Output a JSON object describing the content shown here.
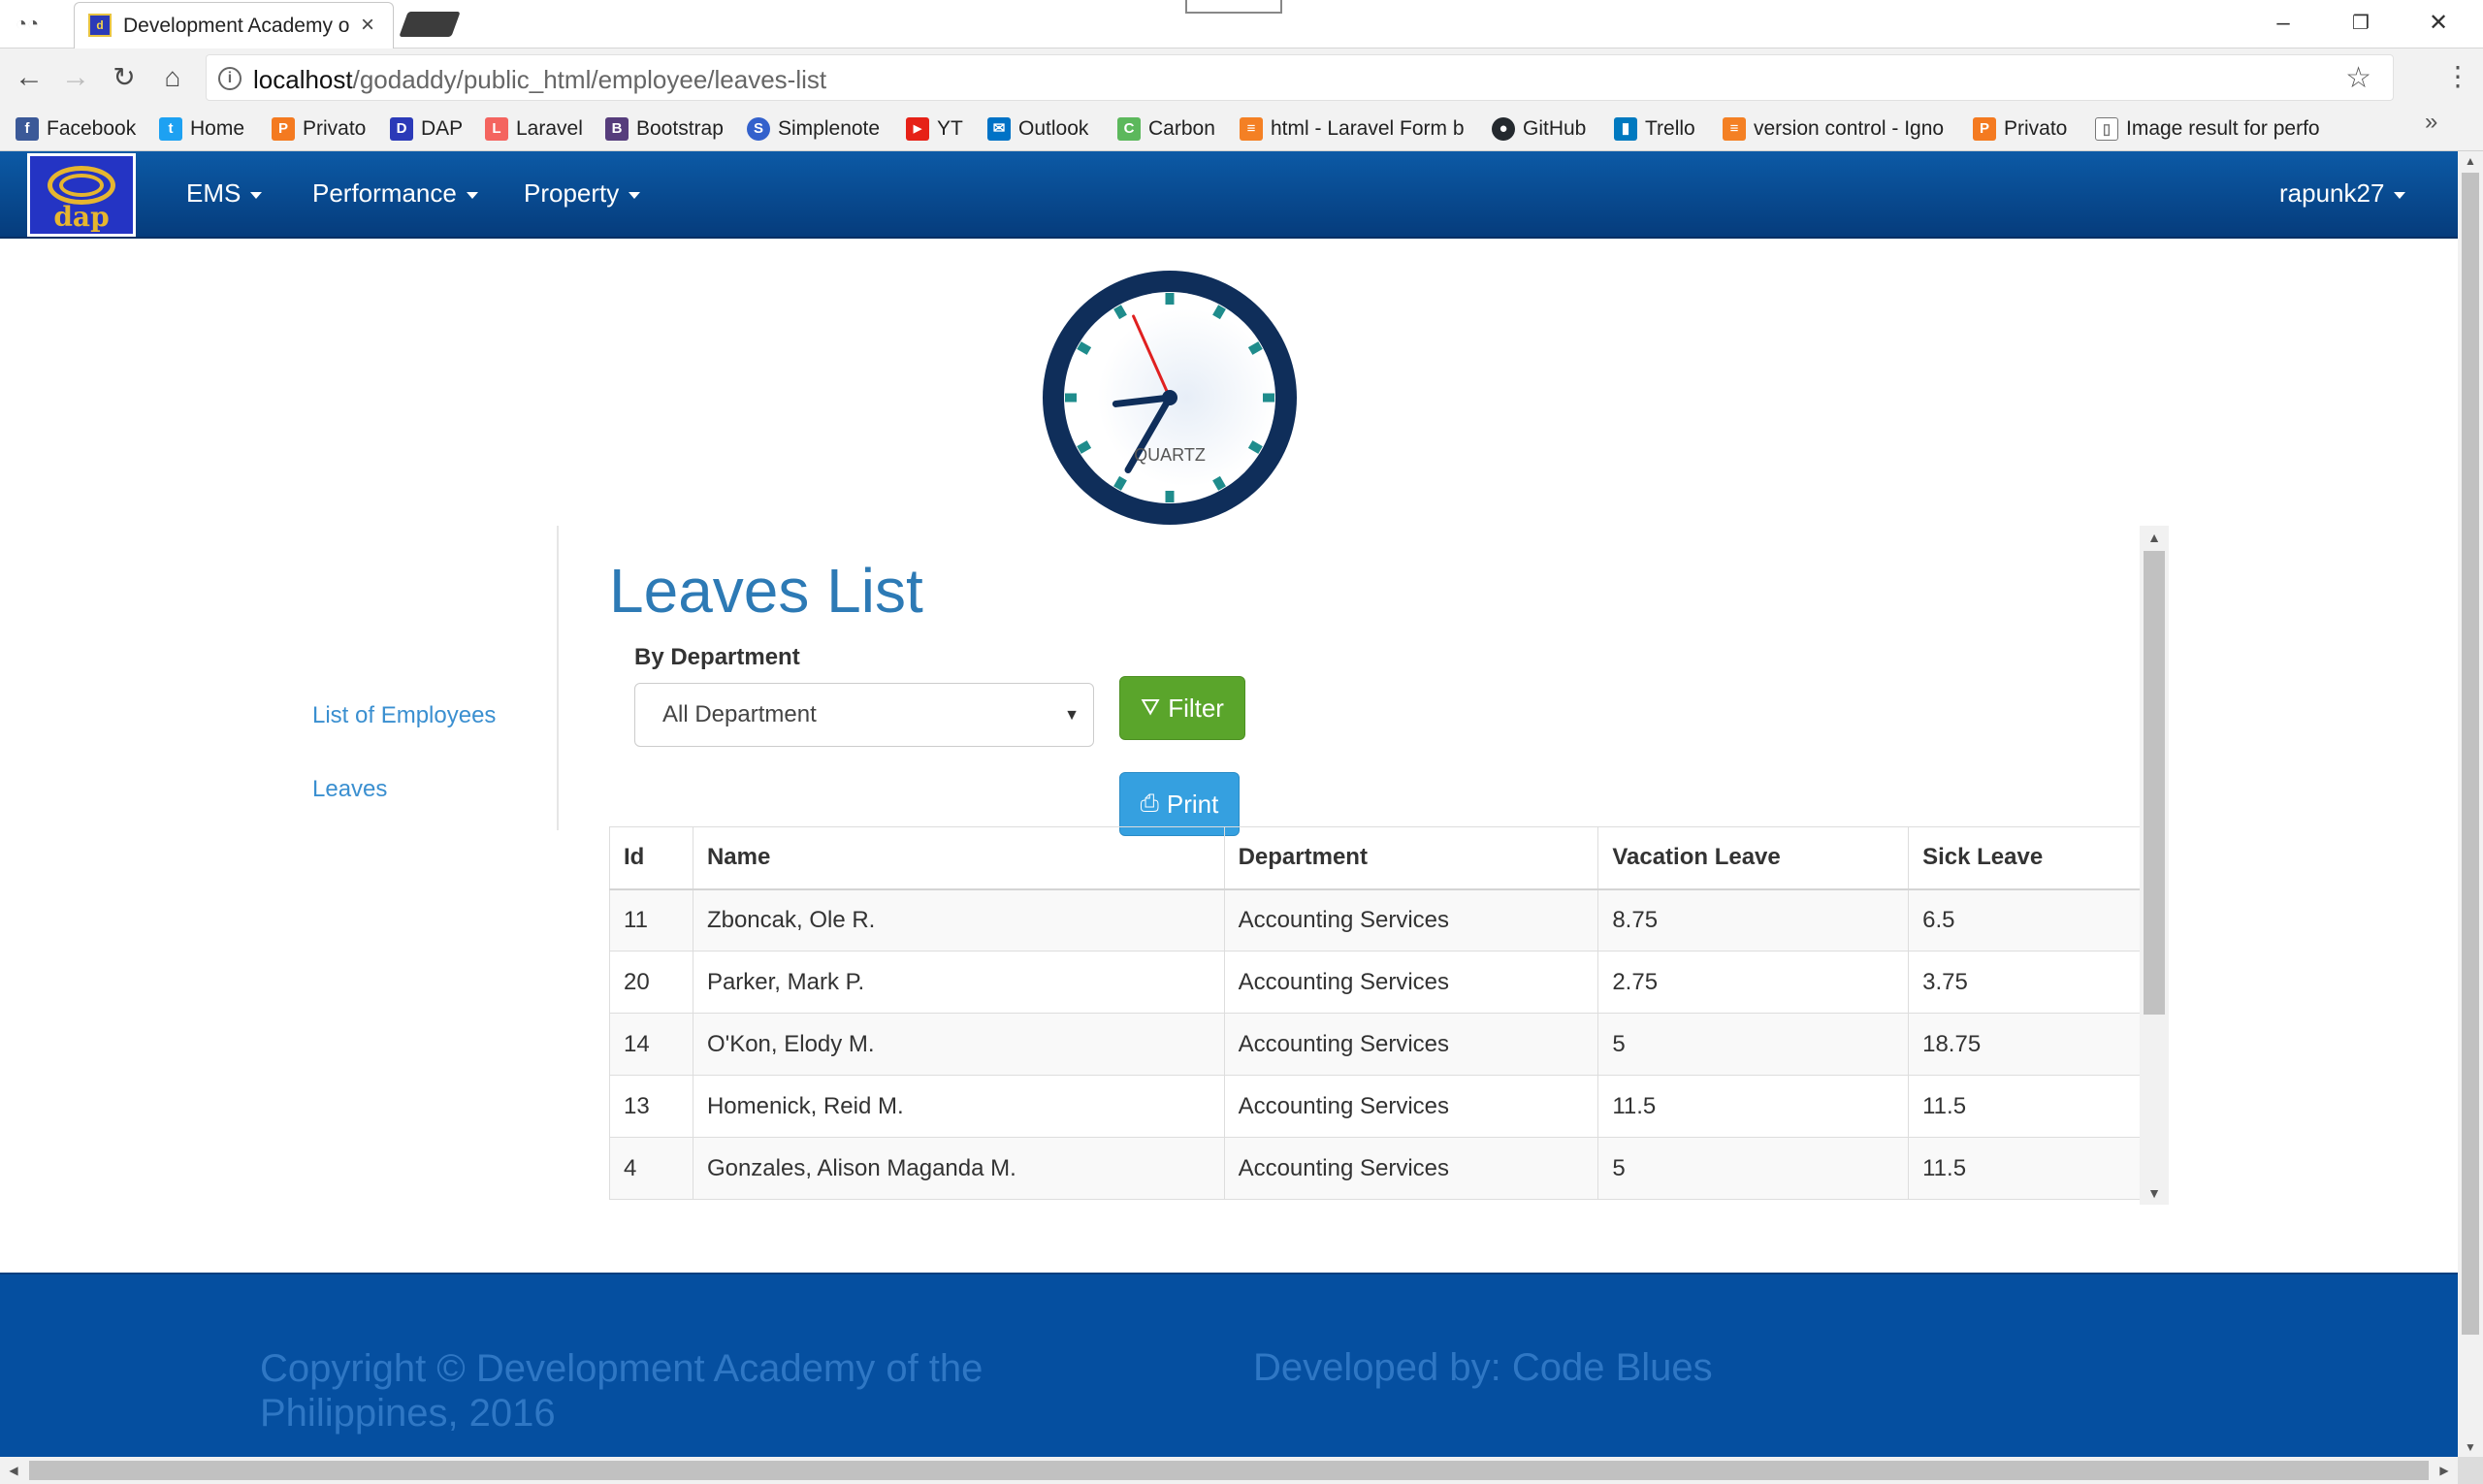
{
  "browser": {
    "tab_title": "Development Academy o",
    "tab_close": "×",
    "url_host": "localhost",
    "url_path": "/godaddy/public_html/employee/leaves-list",
    "bookmarks": [
      {
        "label": "Facebook",
        "icon": "facebook-icon",
        "color": "#3b5998",
        "glyph": "f"
      },
      {
        "label": "Home",
        "icon": "twitter-icon",
        "color": "#1da1f2",
        "glyph": "t"
      },
      {
        "label": "Privato",
        "icon": "privato-icon",
        "color": "#f47a20",
        "glyph": "P"
      },
      {
        "label": "DAP",
        "icon": "dap-icon",
        "color": "#2b3ab8",
        "glyph": "D"
      },
      {
        "label": "Laravel",
        "icon": "laravel-icon",
        "color": "#f4645f",
        "glyph": "L"
      },
      {
        "label": "Bootstrap",
        "icon": "bootstrap-icon",
        "color": "#563d7c",
        "glyph": "B"
      },
      {
        "label": "Simplenote",
        "icon": "simplenote-icon",
        "color": "#3361cc",
        "glyph": "S"
      },
      {
        "label": "YT",
        "icon": "youtube-icon",
        "color": "#e62117",
        "glyph": "▶"
      },
      {
        "label": "Outlook",
        "icon": "outlook-icon",
        "color": "#0072c6",
        "glyph": "✉"
      },
      {
        "label": "Carbon",
        "icon": "carbon-icon",
        "color": "#5cb85c",
        "glyph": "C"
      },
      {
        "label": "html - Laravel Form b",
        "icon": "stackoverflow-icon",
        "color": "#f48024",
        "glyph": "≡"
      },
      {
        "label": "GitHub",
        "icon": "github-icon",
        "color": "#24292e",
        "glyph": "●"
      },
      {
        "label": "Trello",
        "icon": "trello-icon",
        "color": "#0079bf",
        "glyph": "▮"
      },
      {
        "label": "version control - Igno",
        "icon": "stackoverflow-icon",
        "color": "#f48024",
        "glyph": "≡"
      },
      {
        "label": "Privato",
        "icon": "privato-icon",
        "color": "#f47a20",
        "glyph": "P"
      },
      {
        "label": "Image result for perfo",
        "icon": "page-icon",
        "color": "#ffffff",
        "glyph": "▯"
      }
    ],
    "bookmarks_more": "»"
  },
  "navbar": {
    "logo_text": "dap",
    "menus": [
      "EMS",
      "Performance",
      "Property"
    ],
    "user": "rapunk27"
  },
  "clock": {
    "brand": "QUARTZ",
    "hour": 8.78,
    "minute": 35,
    "second": 56
  },
  "sidebar": {
    "links": [
      "List of Employees",
      "Leaves"
    ]
  },
  "main": {
    "title": "Leaves List",
    "filter_label": "By Department",
    "department_selected": "All Department",
    "filter_button": "Filter",
    "print_button": "Print",
    "table": {
      "columns": [
        "Id",
        "Name",
        "Department",
        "Vacation Leave",
        "Sick Leave"
      ],
      "rows": [
        [
          "11",
          "Zboncak, Ole R.",
          "Accounting Services",
          "8.75",
          "6.5"
        ],
        [
          "20",
          "Parker, Mark P.",
          "Accounting Services",
          "2.75",
          "3.75"
        ],
        [
          "14",
          "O'Kon, Elody M.",
          "Accounting Services",
          "5",
          "18.75"
        ],
        [
          "13",
          "Homenick, Reid M.",
          "Accounting Services",
          "11.5",
          "11.5"
        ],
        [
          "4",
          "Gonzales, Alison Maganda M.",
          "Accounting Services",
          "5",
          "11.5"
        ]
      ]
    }
  },
  "footer": {
    "copyright": "Copyright © Development Academy of the Philippines, 2016",
    "developed_by": "Developed by: Code Blues"
  },
  "colors": {
    "navbar": "#0a4f96",
    "title": "#2d7ab5",
    "filter_button": "#5aa52b",
    "print_button": "#35a0e0",
    "footer": "#054fa0"
  }
}
